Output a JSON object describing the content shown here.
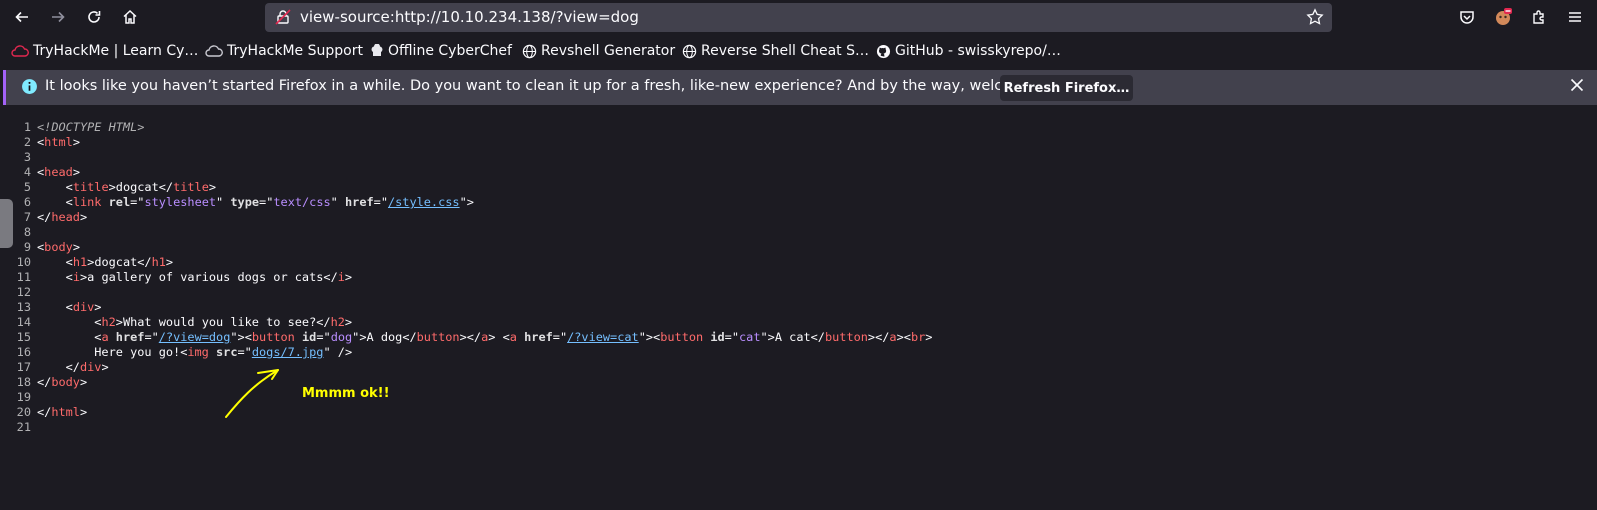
{
  "toolbar": {
    "url": "view-source:http://10.10.234.138/?view=dog",
    "icons": [
      "back-icon",
      "forward-icon",
      "reload-icon",
      "home-icon",
      "lock-icon",
      "star-icon",
      "pocket-icon",
      "extension-icon",
      "puzzle-icon",
      "menu-icon"
    ]
  },
  "bookmarks": [
    {
      "label": "TryHackMe | Learn Cy…",
      "icon": "tryhackme-icon"
    },
    {
      "label": "TryHackMe Support",
      "icon": "cloud-icon"
    },
    {
      "label": "Offline CyberChef",
      "icon": "chef-icon"
    },
    {
      "label": "Revshell Generator",
      "icon": "globe-icon"
    },
    {
      "label": "Reverse Shell Cheat S…",
      "icon": "globe-icon"
    },
    {
      "label": "GitHub - swisskyrepo/…",
      "icon": "github-icon"
    }
  ],
  "notification": {
    "message": "It looks like you haven’t started Firefox in a while. Do you want to clean it up for a fresh, like-new experience? And by the way, welcome back!",
    "button_label": "Refresh Firefox…"
  },
  "source_lines": [
    "<!DOCTYPE HTML>",
    "<html>",
    "",
    "<head>",
    "    <title>dogcat</title>",
    "    <link rel=\"stylesheet\" type=\"text/css\" href=\"/style.css\">",
    "</head>",
    "",
    "<body>",
    "    <h1>dogcat</h1>",
    "    <i>a gallery of various dogs or cats</i>",
    "",
    "    <div>",
    "        <h2>What would you like to see?</h2>",
    "        <a href=\"/?view=dog\"><button id=\"dog\">A dog</button></a> <a href=\"/?view=cat\"><button id=\"cat\">A cat</button></a><br>",
    "        Here you go!<img src=\"dogs/7.jpg\" />",
    "    </div>",
    "</body>",
    "",
    "</html>",
    ""
  ],
  "annotation": {
    "text": "Mmmm ok!!",
    "color": "#ffff00"
  },
  "colors": {
    "background": "#1c1b22",
    "toolbar_field": "#42414d",
    "notification_accent": "#a362f7"
  }
}
